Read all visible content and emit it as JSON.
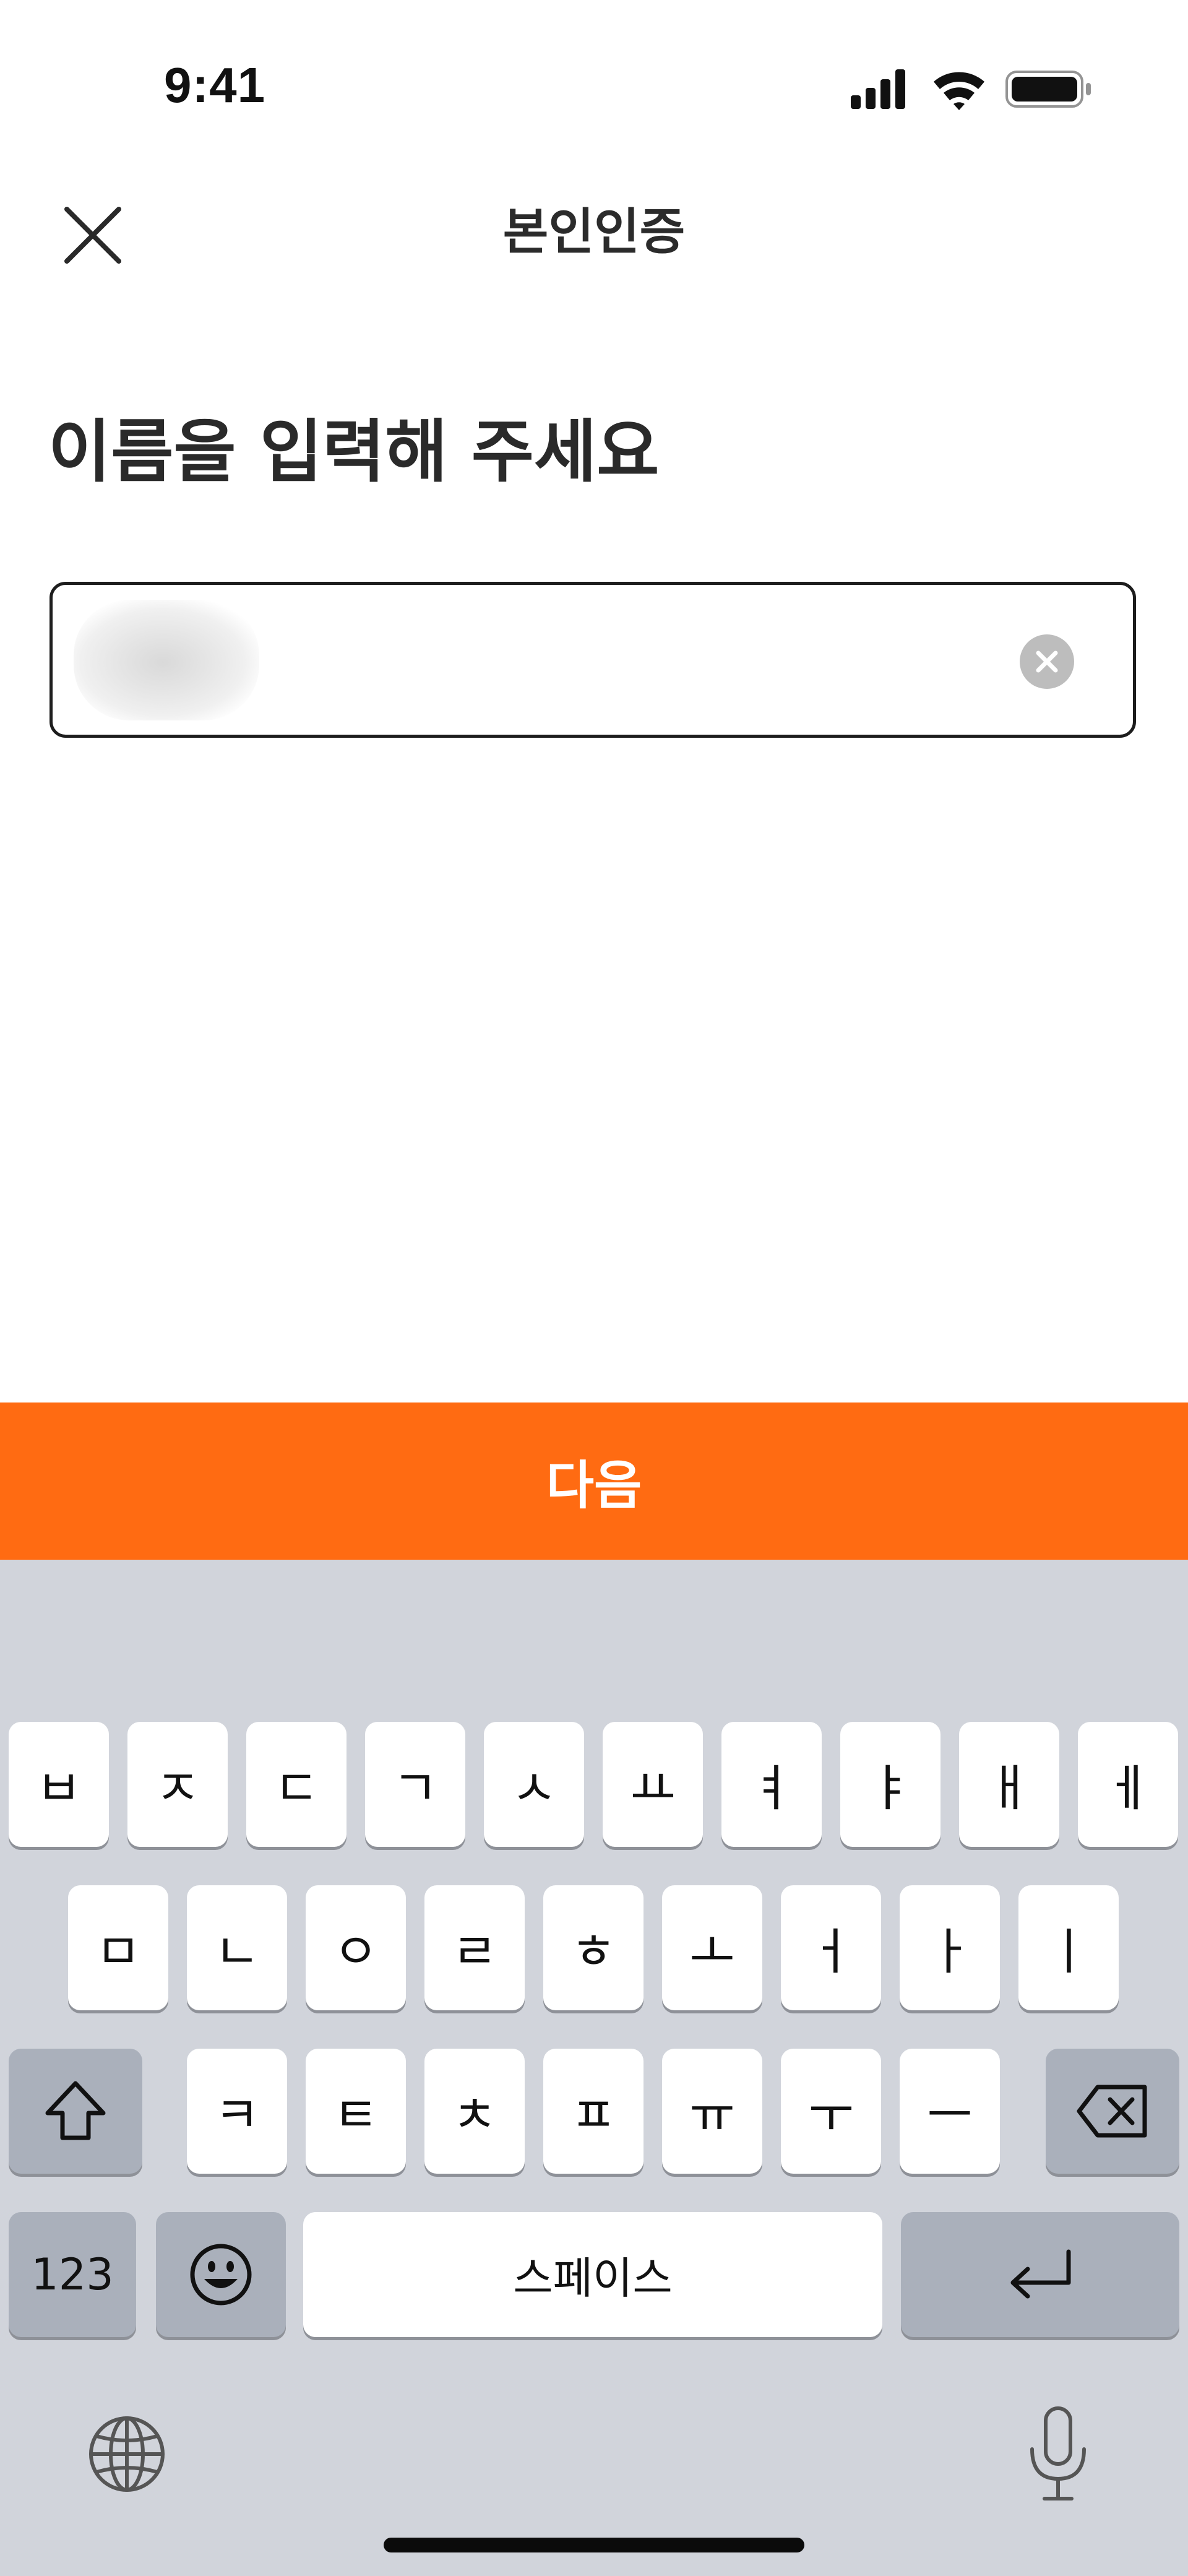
{
  "status_bar": {
    "time": "9:41",
    "icons": [
      "signal-icon",
      "wifi-icon",
      "battery-icon"
    ]
  },
  "nav": {
    "title": "본인인증",
    "close_icon": "close-icon"
  },
  "form": {
    "heading": "이름을 입력해 주세요",
    "name_field": {
      "value": "",
      "value_redacted": true,
      "clear_icon": "clear-icon"
    }
  },
  "actions": {
    "next_label": "다음"
  },
  "keyboard": {
    "row1": [
      "ㅂ",
      "ㅈ",
      "ㄷ",
      "ㄱ",
      "ㅅ",
      "ㅛ",
      "ㅕ",
      "ㅑ",
      "ㅐ",
      "ㅔ"
    ],
    "row2": [
      "ㅁ",
      "ㄴ",
      "ㅇ",
      "ㄹ",
      "ㅎ",
      "ㅗ",
      "ㅓ",
      "ㅏ",
      "ㅣ"
    ],
    "row3": [
      "ㅋ",
      "ㅌ",
      "ㅊ",
      "ㅍ",
      "ㅠ",
      "ㅜ",
      "ㅡ"
    ],
    "numbers_label": "123",
    "space_label": "스페이스",
    "icons": [
      "shift-icon",
      "backspace-icon",
      "emoji-icon",
      "return-icon",
      "globe-icon",
      "microphone-icon"
    ]
  },
  "colors": {
    "accent": "#ff6b12",
    "keyboard_bg": "#d1d4db",
    "function_key": "#aab0bb"
  }
}
